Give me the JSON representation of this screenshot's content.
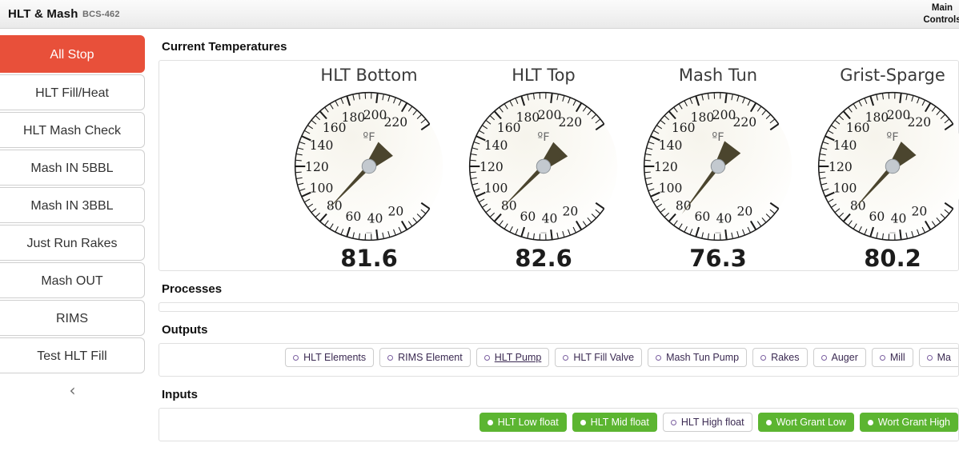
{
  "header": {
    "title": "HLT & Mash",
    "model": "BCS-462",
    "right_label": "Main Controls"
  },
  "sidebar": {
    "collapse_icon": "chevron-left",
    "collapse_glyph": "‹",
    "items": [
      {
        "label": "All Stop",
        "style": "danger"
      },
      {
        "label": "HLT Fill/Heat",
        "style": "normal"
      },
      {
        "label": "HLT Mash Check",
        "style": "normal"
      },
      {
        "label": "Mash IN 5BBL",
        "style": "normal"
      },
      {
        "label": "Mash IN 3BBL",
        "style": "normal"
      },
      {
        "label": "Just Run Rakes",
        "style": "normal"
      },
      {
        "label": "Mash OUT",
        "style": "normal"
      },
      {
        "label": "RIMS",
        "style": "normal"
      },
      {
        "label": "Test HLT Fill",
        "style": "normal"
      }
    ]
  },
  "sections": {
    "temperatures": "Current Temperatures",
    "processes": "Processes",
    "outputs": "Outputs",
    "inputs": "Inputs"
  },
  "gauges": {
    "unit": "ºF",
    "min": 0,
    "max": 240,
    "tick_labels": [
      20,
      40,
      60,
      80,
      100,
      120,
      140,
      160,
      180,
      200,
      220
    ],
    "items": [
      {
        "title": "HLT Bottom",
        "value": "81.6",
        "reading": 81.6
      },
      {
        "title": "HLT Top",
        "value": "82.6",
        "reading": 82.6
      },
      {
        "title": "Mash Tun",
        "value": "76.3",
        "reading": 76.3
      },
      {
        "title": "Grist-Sparge",
        "value": "80.2",
        "reading": 80.2
      }
    ]
  },
  "processes": {
    "items": []
  },
  "outputs": {
    "items": [
      {
        "label": "HLT Elements",
        "state": "off",
        "hovered": false
      },
      {
        "label": "RIMS Element",
        "state": "off",
        "hovered": false
      },
      {
        "label": "HLT Pump",
        "state": "off",
        "hovered": true
      },
      {
        "label": "HLT Fill Valve",
        "state": "off",
        "hovered": false
      },
      {
        "label": "Mash Tun Pump",
        "state": "off",
        "hovered": false
      },
      {
        "label": "Rakes",
        "state": "off",
        "hovered": false
      },
      {
        "label": "Auger",
        "state": "off",
        "hovered": false
      },
      {
        "label": "Mill",
        "state": "off",
        "hovered": false
      },
      {
        "label": "Ma",
        "state": "off",
        "hovered": false,
        "clipped": true
      }
    ]
  },
  "inputs": {
    "items": [
      {
        "label": "HLT Low float",
        "state": "on"
      },
      {
        "label": "HLT Mid float",
        "state": "on"
      },
      {
        "label": "HLT High float",
        "state": "off"
      },
      {
        "label": "Wort Grant Low",
        "state": "on"
      },
      {
        "label": "Wort Grant High",
        "state": "on"
      }
    ]
  },
  "colors": {
    "danger": "#e8503a",
    "active_green": "#5cb531",
    "needle": "#4b452e",
    "hub": "#c3c9cf",
    "badge_text": "#3b2a52"
  }
}
